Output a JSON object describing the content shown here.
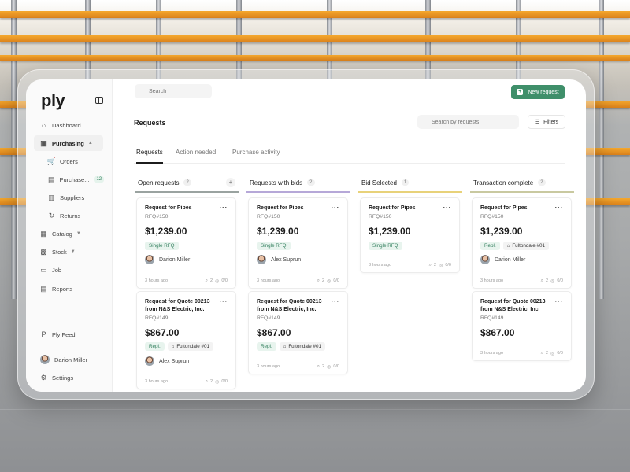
{
  "app": {
    "logo": "ply",
    "search_placeholder": "Search",
    "new_request_label": "New request",
    "brand_color": "#3f8f6a"
  },
  "sidebar": {
    "items": [
      {
        "label": "Dashboard",
        "icon": "home-icon"
      },
      {
        "label": "Purchasing",
        "icon": "cart-box-icon"
      },
      {
        "label": "Orders",
        "icon": "cart-icon"
      },
      {
        "label": "Purchase...",
        "icon": "invoice-icon",
        "count": "12"
      },
      {
        "label": "Suppliers",
        "icon": "building-icon"
      },
      {
        "label": "Returns",
        "icon": "refresh-icon"
      },
      {
        "label": "Catalog",
        "icon": "book-icon"
      },
      {
        "label": "Stock",
        "icon": "grid-icon"
      },
      {
        "label": "Job",
        "icon": "briefcase-icon"
      },
      {
        "label": "Reports",
        "icon": "report-icon"
      }
    ],
    "feed_label": "Ply Feed",
    "user_name": "Darion Miller",
    "settings_label": "Settings"
  },
  "page": {
    "title": "Requests",
    "search_placeholder": "Search by requests",
    "filters_label": "Filters",
    "tabs": [
      "Requests",
      "Action needed",
      "Purchase activity"
    ]
  },
  "columns": [
    {
      "title": "Open requests",
      "count": "2",
      "color": "#9aa3a0",
      "cards": [
        {
          "title": "Request for Pipes",
          "rfq": "RFQ#150",
          "amount": "$1,239.00",
          "tags": [
            "Single RFQ"
          ],
          "location": "",
          "person": "Darion Miller",
          "time": "3 hours ago",
          "attachments": "2",
          "checks": "0/0"
        },
        {
          "title": "Request for Quote 00213 from N&S Electric, Inc.",
          "rfq": "RFQ#149",
          "amount": "$867.00",
          "tags": [
            "Repl."
          ],
          "location": "Fultondale #01",
          "person": "Alex Suprun",
          "time": "3 hours ago",
          "attachments": "2",
          "checks": "0/0"
        }
      ]
    },
    {
      "title": "Requests with bids",
      "count": "2",
      "color": "#b6a8d8",
      "cards": [
        {
          "title": "Request for Pipes",
          "rfq": "RFQ#150",
          "amount": "$1,239.00",
          "tags": [
            "Single RFQ"
          ],
          "location": "",
          "person": "Alex Suprun",
          "time": "3 hours ago",
          "attachments": "2",
          "checks": "0/0"
        },
        {
          "title": "Request for Quote 00213 from N&S Electric, Inc.",
          "rfq": "RFQ#149",
          "amount": "$867.00",
          "tags": [
            "Repl."
          ],
          "location": "Fultondale #01",
          "person": "",
          "time": "3 hours ago",
          "attachments": "2",
          "checks": "0/0"
        }
      ]
    },
    {
      "title": "Bid Selected",
      "count": "1",
      "color": "#e8d27a",
      "cards": [
        {
          "title": "Request for Pipes",
          "rfq": "RFQ#150",
          "amount": "$1,239.00",
          "tags": [
            "Single RFQ"
          ],
          "location": "",
          "person": "",
          "time": "3 hours ago",
          "attachments": "2",
          "checks": "0/0"
        }
      ]
    },
    {
      "title": "Transaction complete",
      "count": "2",
      "color": "#c9c9a0",
      "cards": [
        {
          "title": "Request for Pipes",
          "rfq": "RFQ#150",
          "amount": "$1,239.00",
          "tags": [
            "Repl."
          ],
          "location": "Fultondale #01",
          "person": "Darion Miller",
          "time": "3 hours ago",
          "attachments": "2",
          "checks": "0/0"
        },
        {
          "title": "Request for Quote 00213 from N&S Electric, Inc.",
          "rfq": "RFQ#149",
          "amount": "$867.00",
          "tags": [],
          "location": "",
          "person": "",
          "time": "3 hours ago",
          "attachments": "2",
          "checks": "0/0"
        }
      ]
    }
  ]
}
